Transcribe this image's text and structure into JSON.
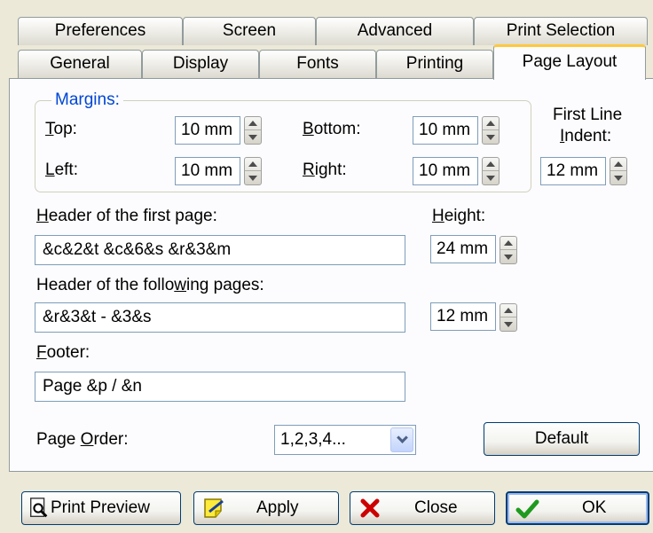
{
  "tabs_back": [
    {
      "label": "Preferences"
    },
    {
      "label": "Screen"
    },
    {
      "label": "Advanced"
    },
    {
      "label": "Print Selection"
    }
  ],
  "tabs_front": [
    {
      "label": "General"
    },
    {
      "label": "Display"
    },
    {
      "label": "Fonts"
    },
    {
      "label": "Printing"
    },
    {
      "label": "Page Layout"
    }
  ],
  "margins": {
    "legend": "Margins:",
    "top": {
      "label_first": "T",
      "label_rest": "op:",
      "value": "10 mm"
    },
    "left": {
      "label_first": "L",
      "label_rest": "eft:",
      "value": "10 mm"
    },
    "bottom": {
      "label_first": "B",
      "label_rest": "ottom:",
      "value": "10 mm"
    },
    "right": {
      "label_first": "R",
      "label_rest": "ight:",
      "value": "10 mm"
    },
    "first_line_indent": {
      "line1": "First Line",
      "line2_first": "I",
      "line2_rest": "ndent:",
      "value": "12 mm"
    }
  },
  "header_first": {
    "label_first": "H",
    "label_rest": "eader of the first page:",
    "value": "&c&2&t &c&6&s &r&3&m",
    "height_label_first": "H",
    "height_label_rest": "eight:",
    "height_value": "24 mm"
  },
  "header_following": {
    "label_pre": "Header of the follo",
    "label_u": "w",
    "label_post": "ing pages:",
    "value": "&r&3&t - &3&s",
    "height_value": "12 mm"
  },
  "footer": {
    "label_first": "F",
    "label_rest": "ooter:",
    "value": "Page &p / &n"
  },
  "page_order": {
    "label_pre": "Page ",
    "label_u": "O",
    "label_post": "rder:",
    "value": "1,2,3,4..."
  },
  "buttons": {
    "default": "Default",
    "print_preview": "Print Preview",
    "apply": "Apply",
    "close": "Close",
    "ok": "OK"
  },
  "icons": {
    "print_preview": "magnifier-page-icon",
    "apply": "note-pencil-icon",
    "close": "red-x-icon",
    "ok": "green-check-icon"
  },
  "colors": {
    "dialog_bg": "#ece9d8",
    "panel_bg": "#fcfcfe",
    "active_tab_accent": "#ffc83c",
    "group_legend": "#0046d5",
    "close_icon": "#cc0000",
    "ok_icon": "#1f9a1f"
  }
}
